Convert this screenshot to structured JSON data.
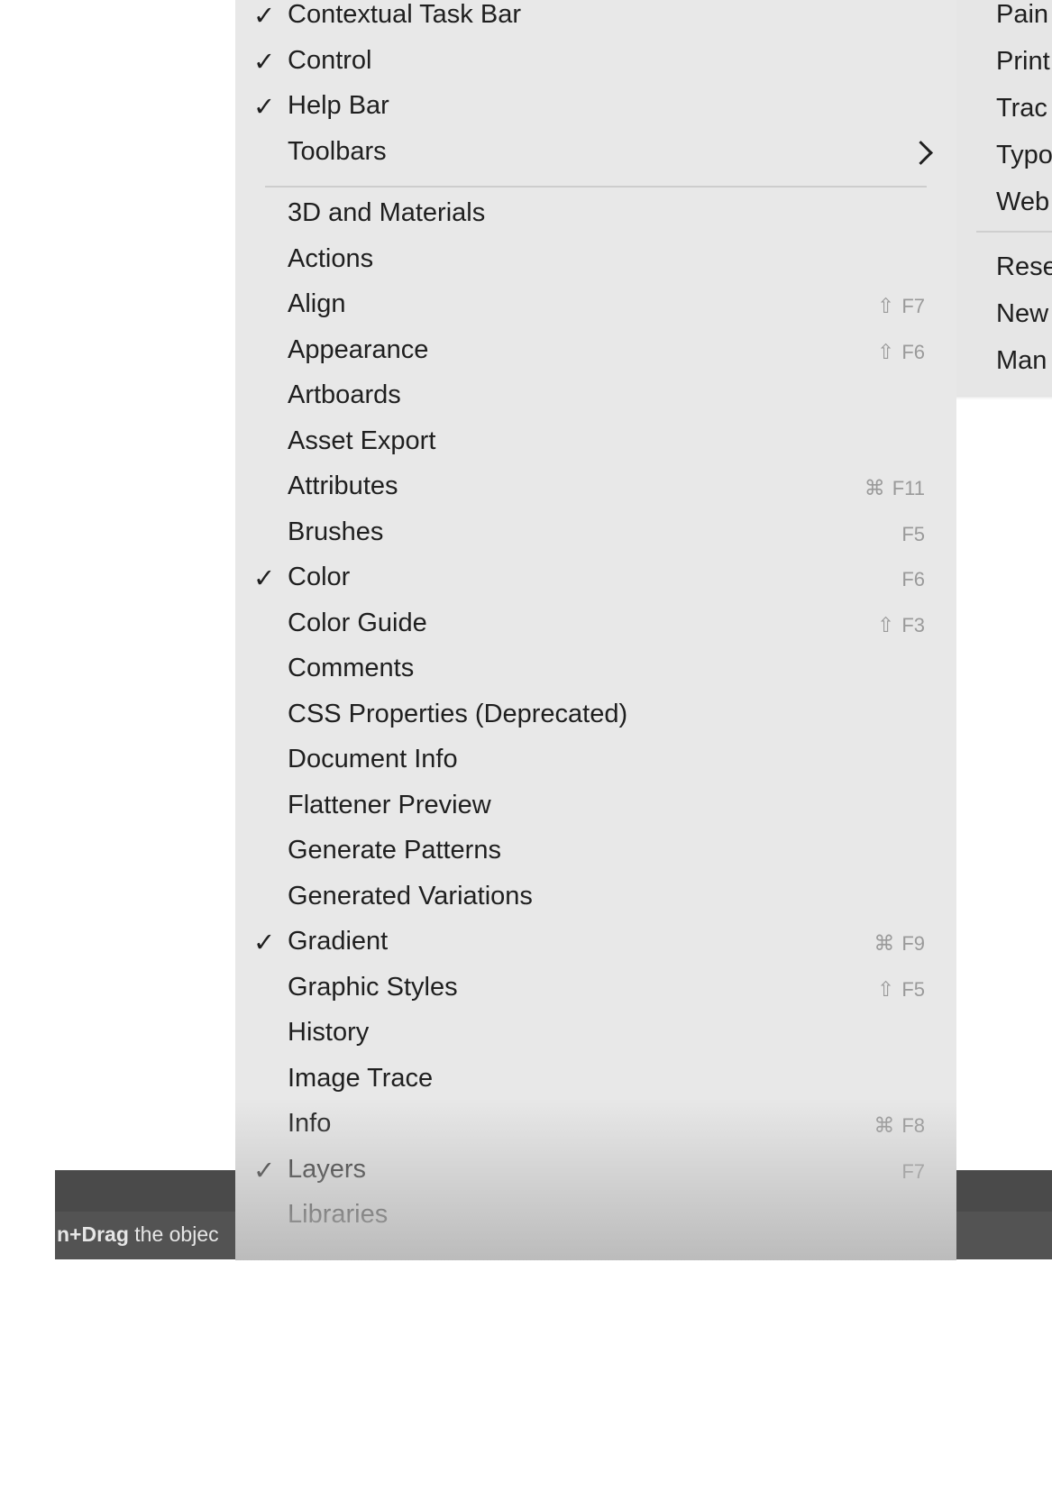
{
  "app_bar": {
    "hint_bold": "n+Drag",
    "hint_rest": " the objec"
  },
  "window_menu": {
    "top_items": [
      {
        "label": "Contextual Task Bar",
        "checked": true,
        "shortcut_mod": "",
        "shortcut_key": ""
      },
      {
        "label": "Control",
        "checked": true,
        "shortcut_mod": "",
        "shortcut_key": ""
      },
      {
        "label": "Help Bar",
        "checked": true,
        "shortcut_mod": "",
        "shortcut_key": ""
      },
      {
        "label": "Toolbars",
        "checked": false,
        "shortcut_mod": "",
        "shortcut_key": "",
        "submenu": true
      }
    ],
    "panel_items": [
      {
        "label": "3D and Materials",
        "checked": false,
        "shortcut_mod": "",
        "shortcut_key": ""
      },
      {
        "label": "Actions",
        "checked": false,
        "shortcut_mod": "",
        "shortcut_key": ""
      },
      {
        "label": "Align",
        "checked": false,
        "shortcut_mod": "⇧",
        "shortcut_key": "F7"
      },
      {
        "label": "Appearance",
        "checked": false,
        "shortcut_mod": "⇧",
        "shortcut_key": "F6"
      },
      {
        "label": "Artboards",
        "checked": false,
        "shortcut_mod": "",
        "shortcut_key": ""
      },
      {
        "label": "Asset Export",
        "checked": false,
        "shortcut_mod": "",
        "shortcut_key": ""
      },
      {
        "label": "Attributes",
        "checked": false,
        "shortcut_mod": "⌘",
        "shortcut_key": "F11"
      },
      {
        "label": "Brushes",
        "checked": false,
        "shortcut_mod": "",
        "shortcut_key": "F5"
      },
      {
        "label": "Color",
        "checked": true,
        "shortcut_mod": "",
        "shortcut_key": "F6"
      },
      {
        "label": "Color Guide",
        "checked": false,
        "shortcut_mod": "⇧",
        "shortcut_key": "F3"
      },
      {
        "label": "Comments",
        "checked": false,
        "shortcut_mod": "",
        "shortcut_key": ""
      },
      {
        "label": "CSS Properties (Deprecated)",
        "checked": false,
        "shortcut_mod": "",
        "shortcut_key": ""
      },
      {
        "label": "Document Info",
        "checked": false,
        "shortcut_mod": "",
        "shortcut_key": ""
      },
      {
        "label": "Flattener Preview",
        "checked": false,
        "shortcut_mod": "",
        "shortcut_key": ""
      },
      {
        "label": "Generate Patterns",
        "checked": false,
        "shortcut_mod": "",
        "shortcut_key": ""
      },
      {
        "label": "Generated Variations",
        "checked": false,
        "shortcut_mod": "",
        "shortcut_key": ""
      },
      {
        "label": "Gradient",
        "checked": true,
        "shortcut_mod": "⌘",
        "shortcut_key": "F9"
      },
      {
        "label": "Graphic Styles",
        "checked": false,
        "shortcut_mod": "⇧",
        "shortcut_key": "F5"
      },
      {
        "label": "History",
        "checked": false,
        "shortcut_mod": "",
        "shortcut_key": ""
      },
      {
        "label": "Image Trace",
        "checked": false,
        "shortcut_mod": "",
        "shortcut_key": ""
      },
      {
        "label": "Info",
        "checked": false,
        "shortcut_mod": "⌘",
        "shortcut_key": "F8"
      },
      {
        "label": "Layers",
        "checked": true,
        "shortcut_mod": "",
        "shortcut_key": "F7"
      },
      {
        "label": "Libraries",
        "checked": false,
        "shortcut_mod": "",
        "shortcut_key": ""
      }
    ]
  },
  "workspace_menu": {
    "items": [
      "Pain",
      "Print",
      "Trac",
      "Typo",
      "Web"
    ],
    "lower_items": [
      "Rese",
      "New",
      "Man"
    ]
  }
}
